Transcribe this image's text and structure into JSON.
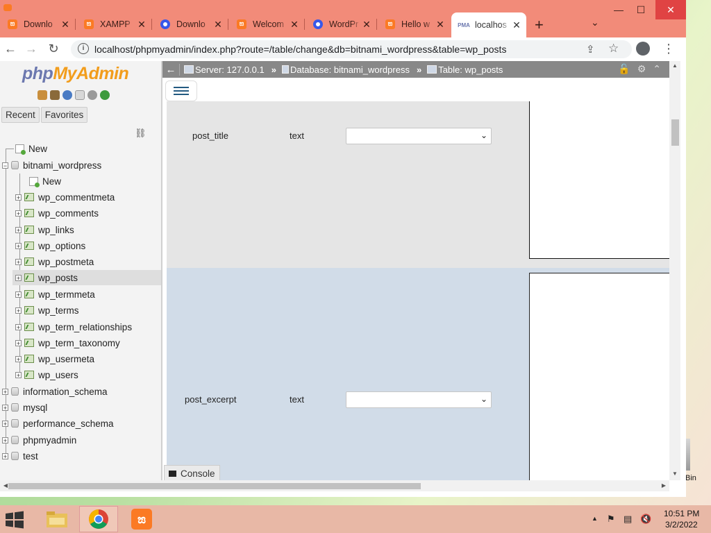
{
  "browser": {
    "tabs": [
      {
        "label": "Downlo",
        "icon": "xampp-icon"
      },
      {
        "label": "XAMPP",
        "icon": "xampp-icon"
      },
      {
        "label": "Downlo",
        "icon": "wordpress-icon"
      },
      {
        "label": "Welcom",
        "icon": "xampp-icon"
      },
      {
        "label": "WordPr",
        "icon": "wordpress-icon"
      },
      {
        "label": "Hello w",
        "icon": "xampp-icon"
      },
      {
        "label": "localhos",
        "icon": "phpmyadmin-icon",
        "active": true
      }
    ],
    "url": "localhost/phpmyadmin/index.php?route=/table/change&db=bitnami_wordpress&table=wp_posts",
    "accent_color": "#f28b79"
  },
  "pma": {
    "logo_php": "php",
    "logo_myadmin": "MyAdmin",
    "nav_tabs": {
      "recent": "Recent",
      "favorites": "Favorites"
    },
    "tree": {
      "new_root": "New",
      "databases": [
        {
          "name": "bitnami_wordpress",
          "expanded": true
        },
        {
          "name": "information_schema"
        },
        {
          "name": "mysql"
        },
        {
          "name": "performance_schema"
        },
        {
          "name": "phpmyadmin"
        },
        {
          "name": "test"
        }
      ],
      "new_table": "New",
      "tables": [
        "wp_commentmeta",
        "wp_comments",
        "wp_links",
        "wp_options",
        "wp_postmeta",
        "wp_posts",
        "wp_termmeta",
        "wp_terms",
        "wp_term_relationships",
        "wp_term_taxonomy",
        "wp_usermeta",
        "wp_users"
      ],
      "selected_table": "wp_posts"
    },
    "breadcrumb": {
      "server": "Server: 127.0.0.1",
      "database": "Database: bitnami_wordpress",
      "table": "Table: wp_posts",
      "separator": "»"
    },
    "fields": [
      {
        "name": "post_title",
        "type": "text",
        "function_value": ""
      },
      {
        "name": "post_excerpt",
        "type": "text",
        "function_value": ""
      }
    ],
    "console_label": "Console"
  },
  "desktop": {
    "recycle_bin_label": "Bin"
  },
  "taskbar": {
    "time": "10:51 PM",
    "date": "3/2/2022"
  }
}
